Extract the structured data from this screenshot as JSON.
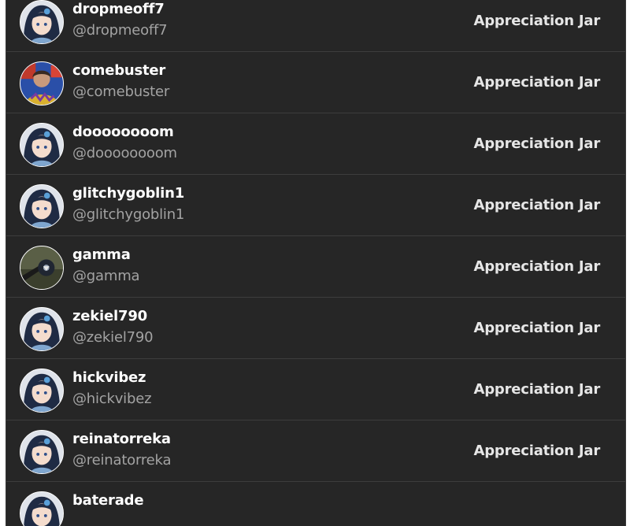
{
  "users": [
    {
      "display_name": "dropmeoff7",
      "handle": "@dropmeoff7",
      "avatar": "anime-avatar-icon",
      "action_label": "Appreciation Jar"
    },
    {
      "display_name": "comebuster",
      "handle": "@comebuster",
      "avatar": "photo-avatar-icon",
      "action_label": "Appreciation Jar"
    },
    {
      "display_name": "doooooooom",
      "handle": "@doooooooom",
      "avatar": "anime-avatar-icon",
      "action_label": "Appreciation Jar"
    },
    {
      "display_name": "glitchygoblin1",
      "handle": "@glitchygoblin1",
      "avatar": "anime-avatar-icon",
      "action_label": "Appreciation Jar"
    },
    {
      "display_name": "gamma",
      "handle": "@gamma",
      "avatar": "photo-avatar-icon",
      "action_label": "Appreciation Jar"
    },
    {
      "display_name": "zekiel790",
      "handle": "@zekiel790",
      "avatar": "anime-avatar-icon",
      "action_label": "Appreciation Jar"
    },
    {
      "display_name": "hickvibez",
      "handle": "@hickvibez",
      "avatar": "anime-avatar-icon",
      "action_label": "Appreciation Jar"
    },
    {
      "display_name": "reinatorreka",
      "handle": "@reinatorreka",
      "avatar": "anime-avatar-icon",
      "action_label": "Appreciation Jar"
    },
    {
      "display_name": "baterade",
      "handle": "",
      "avatar": "anime-avatar-icon",
      "action_label": ""
    }
  ],
  "colors": {
    "panel_bg": "#262626",
    "divider": "#3d3d3d",
    "name_text": "#ffffff",
    "handle_text": "#a3a3a3",
    "link_text": "#e6e6e6"
  }
}
